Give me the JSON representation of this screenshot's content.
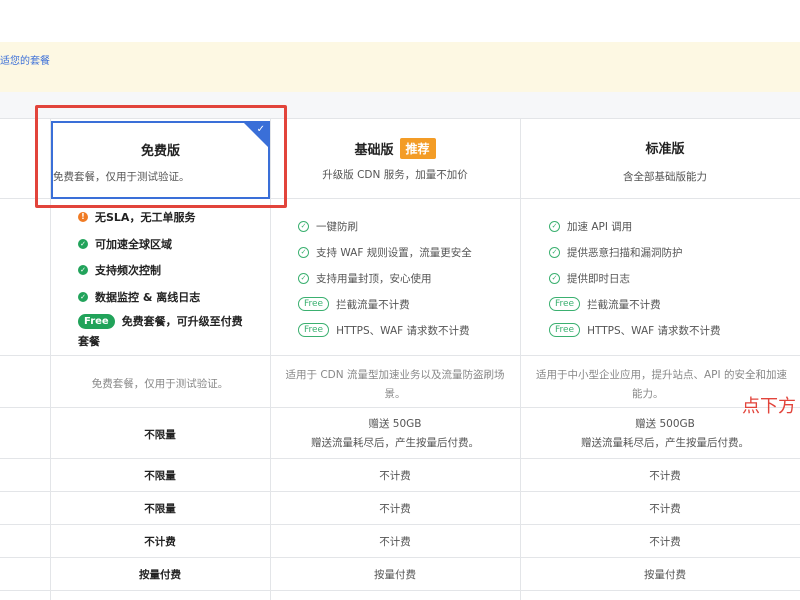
{
  "banner": {
    "text": "适您的套餐"
  },
  "plans": {
    "free": {
      "name": "免费版",
      "desc": "免费套餐，仅用于测试验证。"
    },
    "basic": {
      "name": "基础版",
      "badge": "推荐",
      "desc": "升级版 CDN 服务，加量不加价"
    },
    "standard": {
      "name": "标准版",
      "desc": "含全部基础版能力"
    }
  },
  "free_features": {
    "items": [
      {
        "icon": "warning-icon",
        "text": "无SLA，无工单服务"
      },
      {
        "icon": "check-circle-icon",
        "text": "可加速全球区域"
      },
      {
        "icon": "check-circle-icon",
        "text": "支持频次控制"
      },
      {
        "icon": "check-circle-icon",
        "text": "数据监控 & 离线日志"
      }
    ],
    "free_pill": "Free",
    "free_line": "免费套餐，可升级至付费",
    "free_line2": "套餐"
  },
  "basic_features": {
    "items": [
      {
        "icon": "check-outline-icon",
        "text": "一键防刷"
      },
      {
        "icon": "check-outline-icon",
        "text": "支持 WAF 规则设置，流量更安全"
      },
      {
        "icon": "check-outline-icon",
        "text": "支持用量封顶，安心使用"
      },
      {
        "icon": "free-pill",
        "pill": "Free",
        "text": "拦截流量不计费"
      },
      {
        "icon": "free-pill",
        "pill": "Free",
        "text": "HTTPS、WAF 请求数不计费"
      }
    ]
  },
  "standard_features": {
    "items": [
      {
        "icon": "check-outline-icon",
        "text": "加速 API 调用"
      },
      {
        "icon": "check-outline-icon",
        "text": "提供恶意扫描和漏洞防护"
      },
      {
        "icon": "check-outline-icon",
        "text": "提供即时日志"
      },
      {
        "icon": "free-pill",
        "pill": "Free",
        "text": "拦截流量不计费"
      },
      {
        "icon": "free-pill",
        "pill": "Free",
        "text": "HTTPS、WAF 请求数不计费"
      }
    ]
  },
  "rows": {
    "scenario": {
      "free": "免费套餐，仅用于测试验证。",
      "basic": "适用于 CDN 流量型加速业务以及流量防盗刷场",
      "basic2": "景。",
      "standard": "适用于中小型企业应用，提升站点、API 的安全和加速",
      "standard2": "能力。"
    },
    "traffic": {
      "free": "不限量",
      "basic": "赠送 50GB",
      "basic_sub": "赠送流量耗尽后，产生按量后付费。",
      "standard": "赠送 500GB",
      "standard_sub": "赠送流量耗尽后，产生按量后付费。"
    },
    "row3": {
      "free": "不限量",
      "basic": "不计费",
      "standard": "不计费"
    },
    "row4": {
      "free": "不限量",
      "basic": "不计费",
      "standard": "不计费"
    },
    "row5": {
      "free": "不计费",
      "basic": "不计费",
      "standard": "不计费"
    },
    "row6": {
      "free": "按量付费",
      "basic": "按量付费",
      "standard": "按量付费"
    }
  },
  "annotation": {
    "text": "点下方"
  },
  "colors": {
    "accent": "#3a6fd8",
    "highlight": "#e2443b",
    "badge": "#f39c26",
    "ok": "#22a35b"
  }
}
